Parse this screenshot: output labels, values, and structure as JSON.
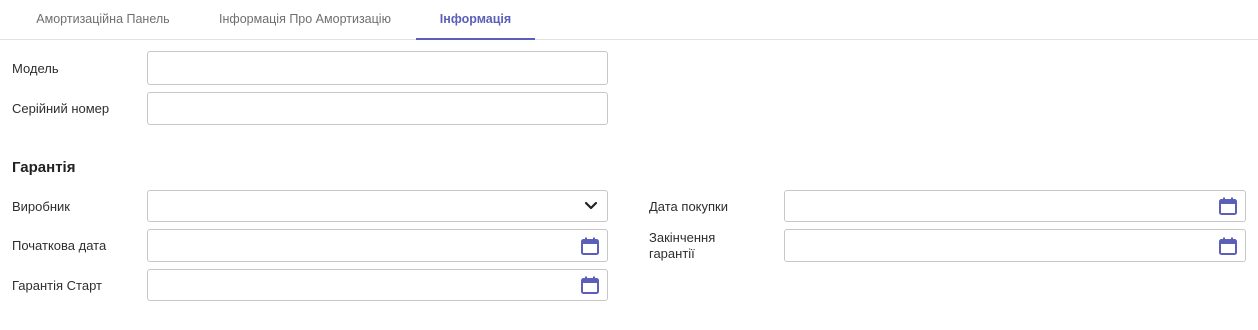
{
  "tabs": [
    "Амортизаційна Панель",
    "Інформація Про Амортизацію",
    "Інформація"
  ],
  "active_tab": "Інформація",
  "accent_color": "#5b5fb7",
  "fields": {
    "model": {
      "label": "Модель",
      "value": ""
    },
    "serial": {
      "label": "Серійний номер",
      "value": ""
    }
  },
  "warranty": {
    "title": "Гарантія",
    "manufacturer": {
      "label": "Виробник",
      "value": "",
      "icon": "chevron-down-icon"
    },
    "start_date": {
      "label": "Початкова дата",
      "value": "",
      "icon": "calendar-icon"
    },
    "warranty_start": {
      "label": "Гарантія Старт",
      "value": "",
      "icon": "calendar-icon"
    },
    "purchase_date": {
      "label": "Дата покупки",
      "value": "",
      "icon": "calendar-icon"
    },
    "warranty_end": {
      "label": "Закінчення гарантії",
      "value": "",
      "icon": "calendar-icon"
    }
  }
}
